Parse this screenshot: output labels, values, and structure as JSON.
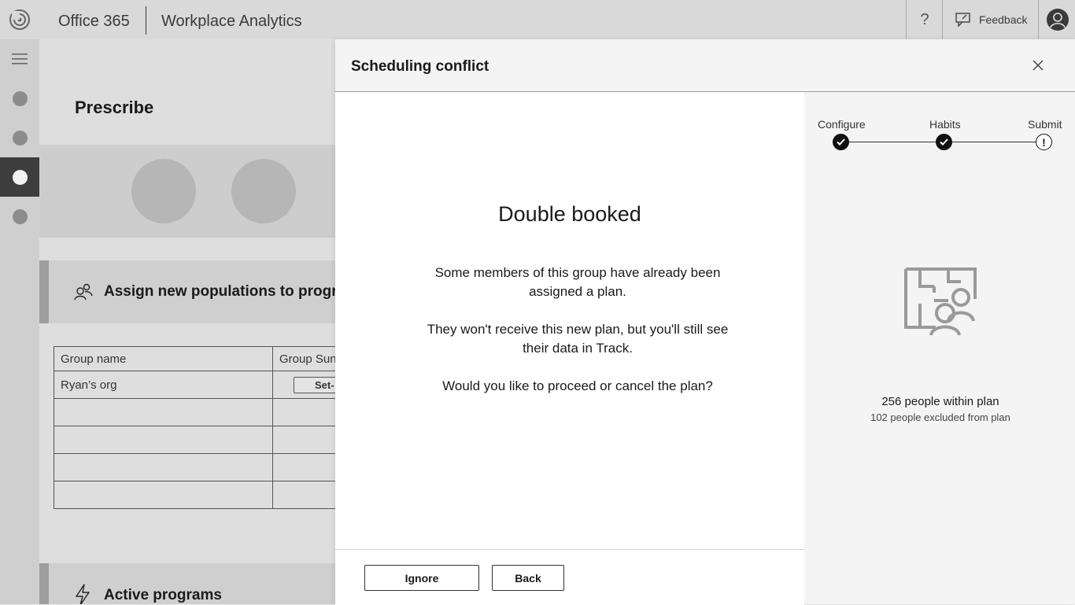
{
  "topbar": {
    "app_title": "Office 365",
    "product_title": "Workplace Analytics",
    "help_label": "?",
    "feedback_label": "Feedback"
  },
  "background": {
    "page_title": "Prescribe",
    "assign_section_title": "Assign new populations to progr",
    "table": {
      "headers": [
        "Group name",
        "Group Sun"
      ],
      "rows": [
        {
          "name": "Ryan’s org",
          "action": "Set-"
        },
        {
          "name": "",
          "action": ""
        },
        {
          "name": "",
          "action": ""
        },
        {
          "name": "",
          "action": ""
        },
        {
          "name": "",
          "action": ""
        }
      ]
    },
    "active_section_title": "Active programs"
  },
  "dialog": {
    "title": "Scheduling conflict",
    "heading": "Double booked",
    "message_1": "Some members of this group have already been assigned a plan.",
    "message_2": "They won't receive this new plan, but you'll still see their data in Track.",
    "message_3": "Would you like to proceed or cancel the plan?",
    "ignore_label": "Ignore",
    "back_label": "Back"
  },
  "stepper": {
    "steps": [
      {
        "label": "Configure",
        "status": "complete"
      },
      {
        "label": "Habits",
        "status": "complete"
      },
      {
        "label": "Submit",
        "status": "warning",
        "symbol": "!"
      }
    ]
  },
  "plan_summary": {
    "within_text": "256 people within plan",
    "excluded_text": "102 people excluded from plan"
  }
}
